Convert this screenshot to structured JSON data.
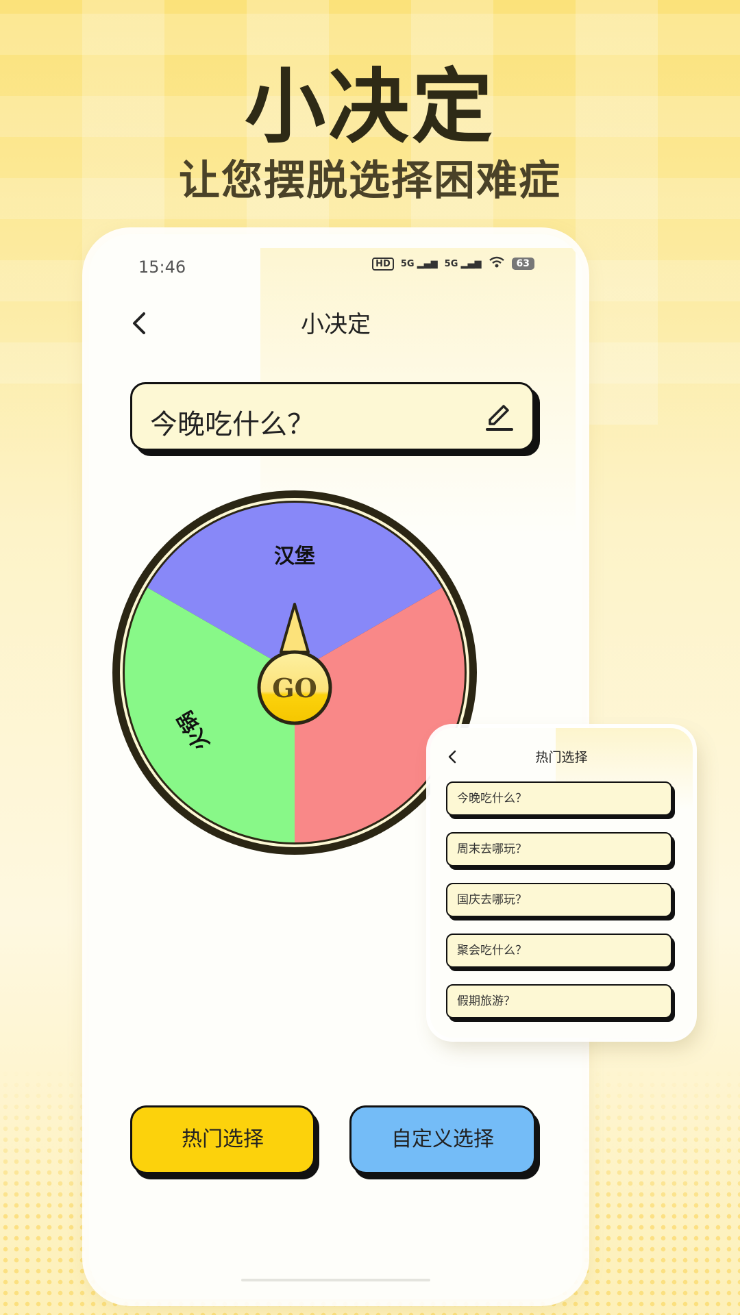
{
  "hero": {
    "title": "小决定",
    "subtitle": "让您摆脱选择困难症"
  },
  "status_bar": {
    "time": "15:46",
    "hd": "HD",
    "net1": "5G",
    "net2": "5G",
    "battery": "63"
  },
  "nav": {
    "title": "小决定"
  },
  "question": {
    "value": "今晚吃什么？"
  },
  "wheel": {
    "go_label": "GO",
    "segments": [
      {
        "label": "汉堡",
        "color": "#8888f8"
      },
      {
        "label": "",
        "color": "#f98888"
      },
      {
        "label": "火锅",
        "color": "#88f888"
      }
    ],
    "rim_color": "#2b2614",
    "knob_color": "#fcd20c"
  },
  "buttons": {
    "hot": "热门选择",
    "custom": "自定义选择"
  },
  "popup": {
    "title": "热门选择",
    "items": [
      "今晚吃什么？",
      "周末去哪玩？",
      "国庆去哪玩？",
      "聚会吃什么？",
      "假期旅游？"
    ]
  },
  "colors": {
    "hot_button": "#fcd20c",
    "custom_button": "#74bcf7",
    "card_fill": "#fdf8d4"
  }
}
